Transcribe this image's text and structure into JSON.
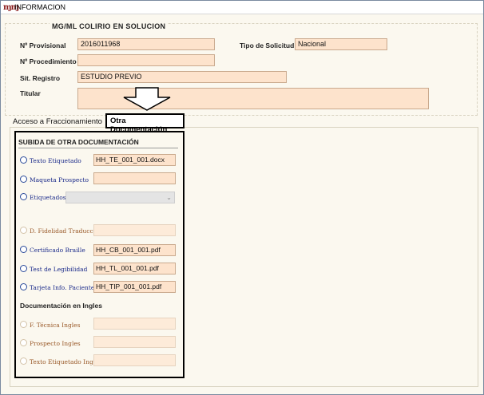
{
  "window": {
    "title": "INFORMACION",
    "app_icon": "m-logo-icon"
  },
  "product": {
    "title": "MG/ML COLIRIO EN SOLUCION"
  },
  "form": {
    "provisional": {
      "label": "Nº Provisional",
      "value": "2016011968"
    },
    "tipo_solicitud": {
      "label": "Tipo de Solicitud",
      "value": "Nacional"
    },
    "procedimiento": {
      "label": "Nº Procedimiento",
      "value": ""
    },
    "sit_registro": {
      "label": "Sit. Registro",
      "value": "ESTUDIO PREVIO"
    },
    "titular": {
      "label": "Titular",
      "value": ""
    }
  },
  "tabs": [
    {
      "label": "Acceso a Fraccionamiento",
      "active": false
    },
    {
      "label": "Otra Documentación",
      "active": true
    }
  ],
  "subida": {
    "title": "SUBIDA DE OTRA DOCUMENTACIÓN",
    "items": [
      {
        "label": "Texto Etiquetado",
        "value": "HH_TE_001_001.docx",
        "enabled": true
      },
      {
        "label": "Maqueta Prospecto",
        "value": "",
        "enabled": true
      },
      {
        "label": "Etiquetados",
        "value": "",
        "enabled": true,
        "type": "dropdown"
      },
      {
        "label": "D. Fidelidad Traducción",
        "value": "",
        "enabled": false
      },
      {
        "label": "Certificado Braille",
        "value": "HH_CB_001_001.pdf",
        "enabled": true
      },
      {
        "label": "Test de Legibilidad",
        "value": "HH_TL_001_001.pdf",
        "enabled": true
      },
      {
        "label": "Tarjeta Info. Paciente",
        "value": "HH_TIP_001_001.pdf",
        "enabled": true
      }
    ],
    "ingles_title": "Documentación en Ingles",
    "ingles_items": [
      {
        "label": "F. Técnica Ingles",
        "value": "",
        "enabled": false
      },
      {
        "label": "Prospecto Ingles",
        "value": "",
        "enabled": false
      },
      {
        "label": "Texto Etiquetado Ingles",
        "value": "",
        "enabled": false
      }
    ]
  },
  "colors": {
    "field_bg": "#fde3cc",
    "panel_bg": "#fbf8ef",
    "label_blue": "#1a2a8a",
    "label_disabled": "#9a5a2a"
  }
}
